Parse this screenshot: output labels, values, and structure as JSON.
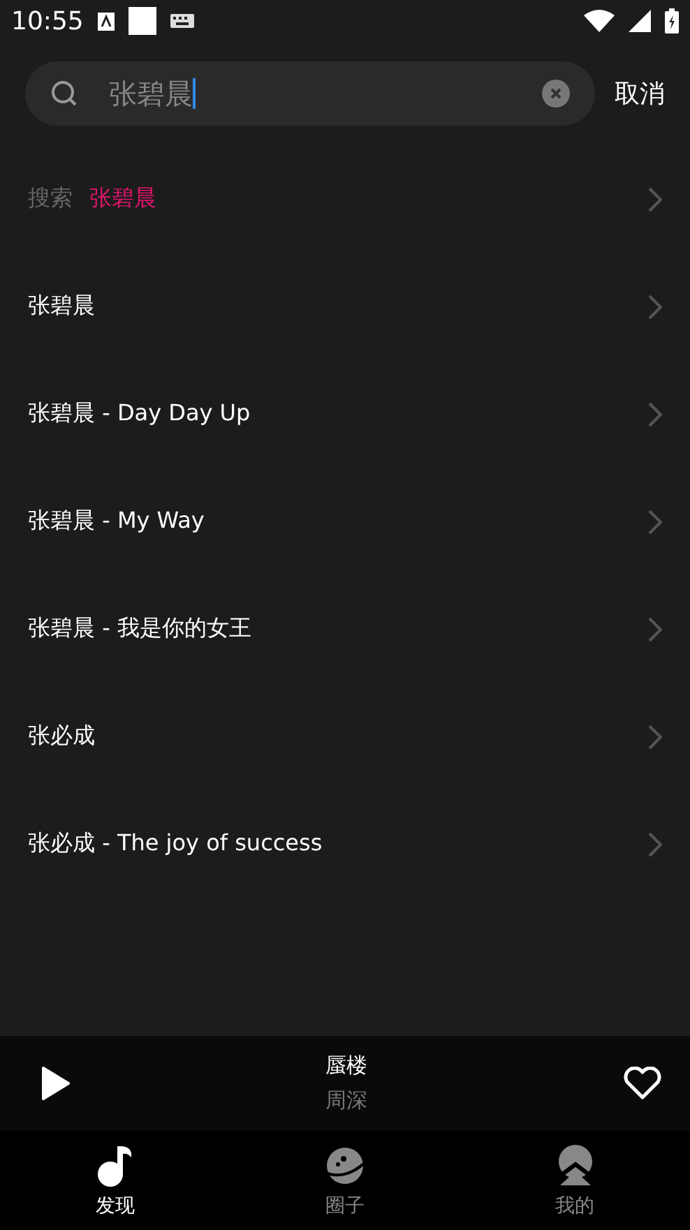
{
  "status_bar": {
    "time": "10:55"
  },
  "search": {
    "value": "张碧晨",
    "cancel": "取消"
  },
  "results": [
    {
      "kind": "search",
      "label": "搜索",
      "query": "张碧晨"
    },
    {
      "kind": "suggestion",
      "text": "张碧晨"
    },
    {
      "kind": "suggestion",
      "text": "张碧晨 - Day Day Up"
    },
    {
      "kind": "suggestion",
      "text": "张碧晨 - My Way"
    },
    {
      "kind": "suggestion",
      "text": "张碧晨 - 我是你的女王"
    },
    {
      "kind": "suggestion",
      "text": "张必成"
    },
    {
      "kind": "suggestion",
      "text": "张必成 - The  joy of success"
    }
  ],
  "player": {
    "title": "蜃楼",
    "artist": "周深",
    "liked": false
  },
  "nav": [
    {
      "label": "发现",
      "selected": true
    },
    {
      "label": "圈子",
      "selected": false
    },
    {
      "label": "我的",
      "selected": false
    }
  ]
}
